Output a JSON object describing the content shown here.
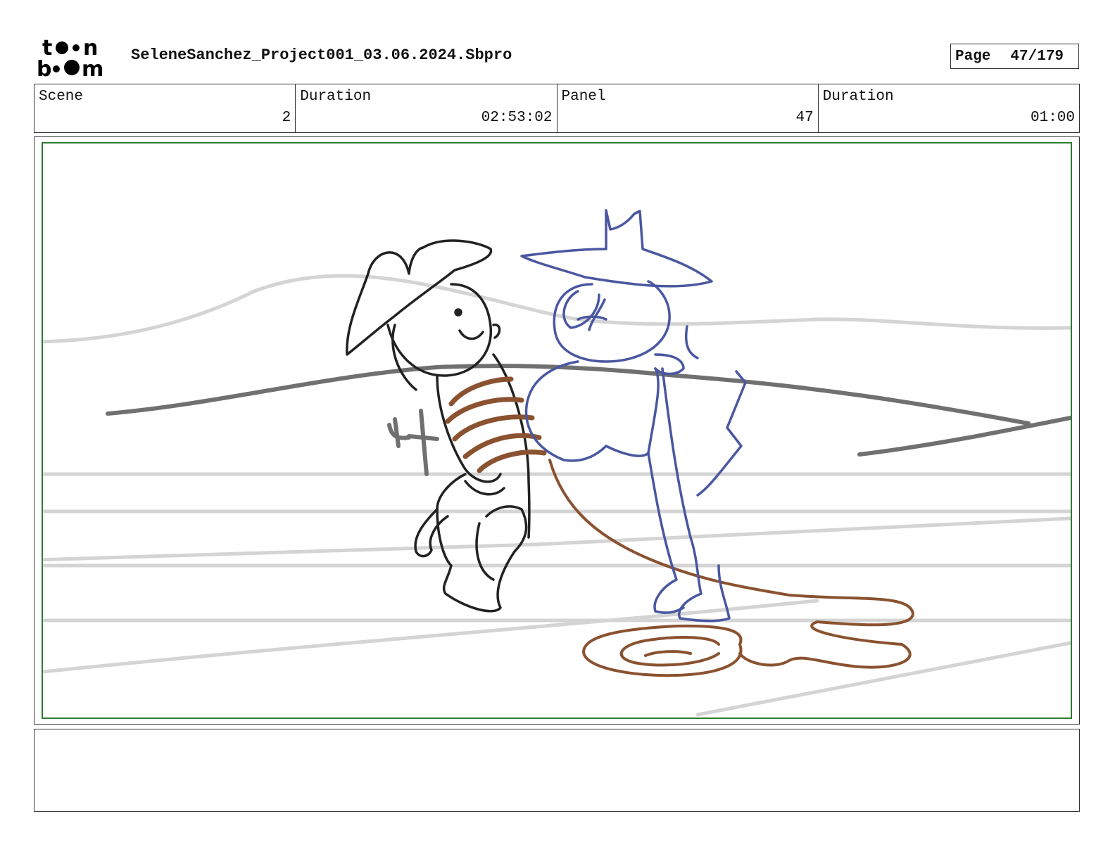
{
  "header": {
    "brand_name": "toonboom",
    "file_title": "SeleneSanchez_Project001_03.06.2024.Sbpro",
    "page_label": "Page",
    "page_value": "47/179"
  },
  "info": [
    {
      "label": "Scene",
      "value": "2"
    },
    {
      "label": "Duration",
      "value": "02:53:02"
    },
    {
      "label": "Panel",
      "value": "47"
    },
    {
      "label": "Duration",
      "value": "01:00"
    }
  ],
  "panel": {
    "frame_color": "#2e7d32",
    "sketch_colors": {
      "background_light": "#cfcfcf",
      "background_dark": "#6e6e6e",
      "cowboy": "#1f1f1f",
      "rope": "#8a5230",
      "catgirl": "#4a57a0"
    }
  },
  "notes": {
    "text": ""
  }
}
